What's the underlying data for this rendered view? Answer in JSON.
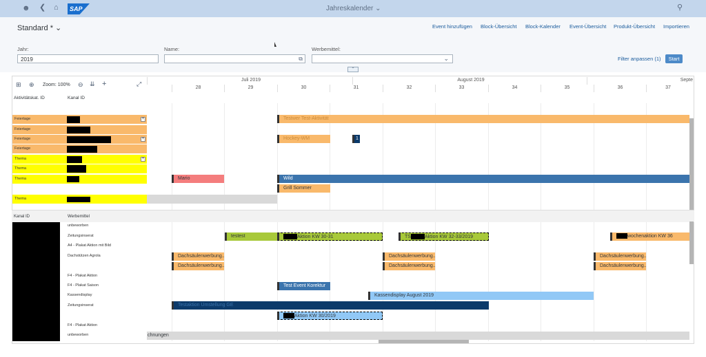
{
  "shell": {
    "title": "Jahreskalender",
    "logo": "SAP",
    "icons": [
      "user-icon",
      "back-icon",
      "home-icon",
      "search-icon"
    ]
  },
  "header": {
    "variant": "Standard *",
    "actions": [
      "Event hinzufügen",
      "Block-Übersicht",
      "Block-Kalender",
      "Event-Übersicht",
      "Produkt-Übersicht",
      "Importieren"
    ]
  },
  "filters": {
    "jahr_label": "Jahr:",
    "jahr_value": "2019",
    "name_label": "Name:",
    "name_value": "",
    "werbemittel_label": "Werbemittel:",
    "werbemittel_value": "",
    "adjust": "Filter anpassen (1)",
    "start": "Start"
  },
  "gantt": {
    "zoom_label": "Zoom: 100%",
    "col1": "Aktivitätskat. ID",
    "col2": "Kanal ID",
    "months": [
      "Juli 2019",
      "August 2019",
      "Septe"
    ],
    "weeks": [
      "28",
      "29",
      "30",
      "31",
      "32",
      "33",
      "34",
      "35",
      "36",
      "37"
    ],
    "upper_rows": [
      {
        "cat": "Feiertage",
        "plus": true
      },
      {
        "cat": "Feiertage",
        "plus": false
      },
      {
        "cat": "Feiertage",
        "plus": true
      },
      {
        "cat": "Feiertage",
        "plus": false
      },
      {
        "cat": "Thema",
        "plus": true
      },
      {
        "cat": "Thema",
        "plus": false
      },
      {
        "cat": "Thema",
        "plus": false
      },
      {
        "cat": "",
        "plus": false
      },
      {
        "cat": "Thema",
        "plus": false
      }
    ],
    "upper_bars": [
      {
        "label": "Testwer Test-Aktivität",
        "color": "#f9b96b"
      },
      {
        "label": "Hockey-WM",
        "color": "#f9b96b"
      },
      {
        "label": "1",
        "color": "#0c3a6a"
      },
      {
        "label": "Mario",
        "color": "#f47d7d"
      },
      {
        "label": "Wild",
        "color": "#3b74ad"
      },
      {
        "label": "Grill Sommer",
        "color": "#f9b96b"
      }
    ],
    "lower_col1": "Kanal ID",
    "lower_col2": "Werbemittel",
    "werbemittel": [
      "unbeworben",
      "Zeitungsinserat",
      "A4 - Plakat Aktion mit Bild",
      "Dachstützen Agrola",
      "",
      "F4 - Plakat Aktion",
      "F4 - Plakat Saison",
      "Kassendisplay",
      "Zeitungsinserat",
      "",
      "F4 - Plakat Aktion",
      "unbeworben"
    ],
    "lower_bars": [
      {
        "label": "testest"
      },
      {
        "label": "Aktion KW 30-31"
      },
      {
        "label": "TS"
      },
      {
        "label": "Aktion KW 32-33/2019"
      },
      {
        "label": "wochenaktion KW 36"
      },
      {
        "label": "Dachsäulenwerbung..."
      },
      {
        "label": "Test Event Korektur"
      },
      {
        "label": "Kassendisplay August 2019"
      },
      {
        "label": "Testaktion Umstellung GE"
      },
      {
        "label": "Aktion KW 30/2019"
      },
      {
        "label": "chnungen"
      }
    ]
  }
}
